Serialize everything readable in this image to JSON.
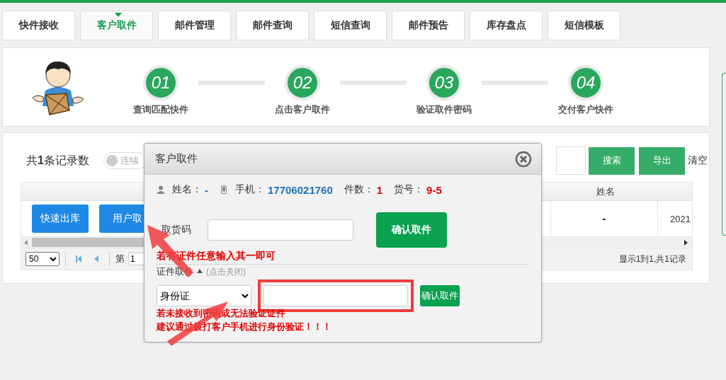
{
  "tabs": [
    {
      "label": "快件接收",
      "selected": false
    },
    {
      "label": "客户取件",
      "selected": true
    },
    {
      "label": "邮件管理",
      "selected": false
    },
    {
      "label": "邮件查询",
      "selected": false
    },
    {
      "label": "短信查询",
      "selected": false
    },
    {
      "label": "邮件预告",
      "selected": false
    },
    {
      "label": "库存盘点",
      "selected": false
    },
    {
      "label": "短信模板",
      "selected": false
    }
  ],
  "steps": [
    {
      "number": "01",
      "label": "查询匹配快件"
    },
    {
      "number": "02",
      "label": "点击客户取件"
    },
    {
      "number": "03",
      "label": "验证取件密码"
    },
    {
      "number": "04",
      "label": "交付客户快件"
    }
  ],
  "records": {
    "count_label": "共**1**条记录数",
    "toggle": {
      "label": "连续",
      "on": false
    },
    "buttons": [
      "搜索",
      "导出"
    ],
    "clear_link": "清空"
  },
  "table": {
    "columns": [
      "姓名"
    ],
    "row": {
      "actions": [
        "快速出库",
        "用户取"
      ],
      "cells": [
        "-",
        "2021"
      ]
    }
  },
  "pager": {
    "page_size": "50",
    "page_label": "第",
    "page": "1",
    "summary": "显示1到1,共1记录"
  },
  "dialog": {
    "title": "客户取件",
    "info": [
      {
        "kind": "person",
        "label": "姓名：",
        "value": "-",
        "color": "#1e6fb8"
      },
      {
        "kind": "phone",
        "label": "手机：",
        "value": "17706021760",
        "color": "#1e6fb8"
      },
      {
        "kind": "plain",
        "label": "件数：",
        "value": "1",
        "color": "#e00000"
      },
      {
        "kind": "plain",
        "label": "货号：",
        "value": "9-5",
        "color": "#e00000"
      }
    ],
    "pickup_code": {
      "label": "取货码",
      "button": "确认取件"
    },
    "note": "若有证件任意输入其一即可",
    "id_section": {
      "label": "证件取件",
      "expanded": true,
      "hint": "(点击关闭)",
      "id_type": "身份证",
      "button": "确认取件",
      "highlighted": true
    },
    "warnings": [
      "若未接收到密码或无法验证证件",
      "建议通过拨打客户手机进行身份验证！！！"
    ]
  }
}
